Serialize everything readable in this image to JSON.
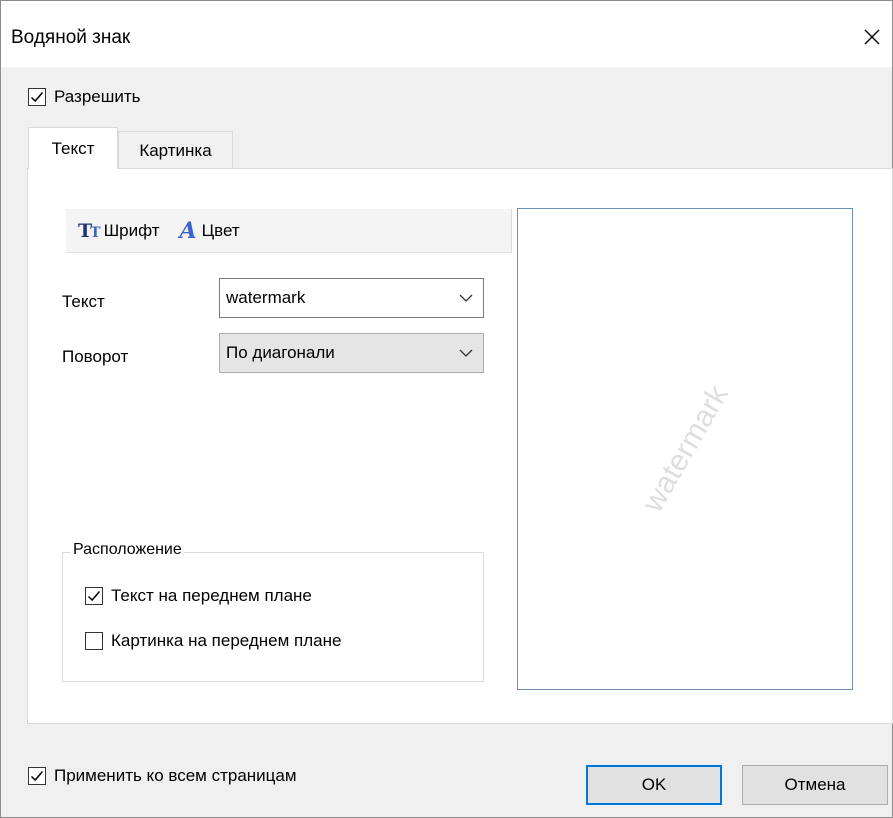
{
  "window": {
    "title": "Водяной знак"
  },
  "enable": {
    "label": "Разрешить",
    "checked": true
  },
  "tabs": [
    {
      "label": "Текст",
      "active": true
    },
    {
      "label": "Картинка",
      "active": false
    }
  ],
  "toolbar": {
    "font_icon": "font-type-icon",
    "font_label": "Шрифт",
    "color_icon": "font-color-icon",
    "color_label": "Цвет"
  },
  "form": {
    "text_label": "Текст",
    "text_value": "watermark",
    "rotation_label": "Поворот",
    "rotation_value": "По диагонали"
  },
  "placement": {
    "title": "Расположение",
    "options": [
      {
        "label": "Текст на переднем плане",
        "checked": true
      },
      {
        "label": "Картинка на переднем плане",
        "checked": false
      }
    ]
  },
  "preview": {
    "watermark_text": "watermark",
    "rotation_deg": -60
  },
  "apply_all": {
    "label": "Применить ко всем страницам",
    "checked": true
  },
  "buttons": {
    "ok_label": "OK",
    "cancel_label": "Отмена"
  },
  "colors": {
    "accent": "#0078d7",
    "preview_border": "#6e8fb5",
    "watermark": "#dedede",
    "panel": "#ffffff",
    "dialog_bg": "#f0f0f0"
  }
}
